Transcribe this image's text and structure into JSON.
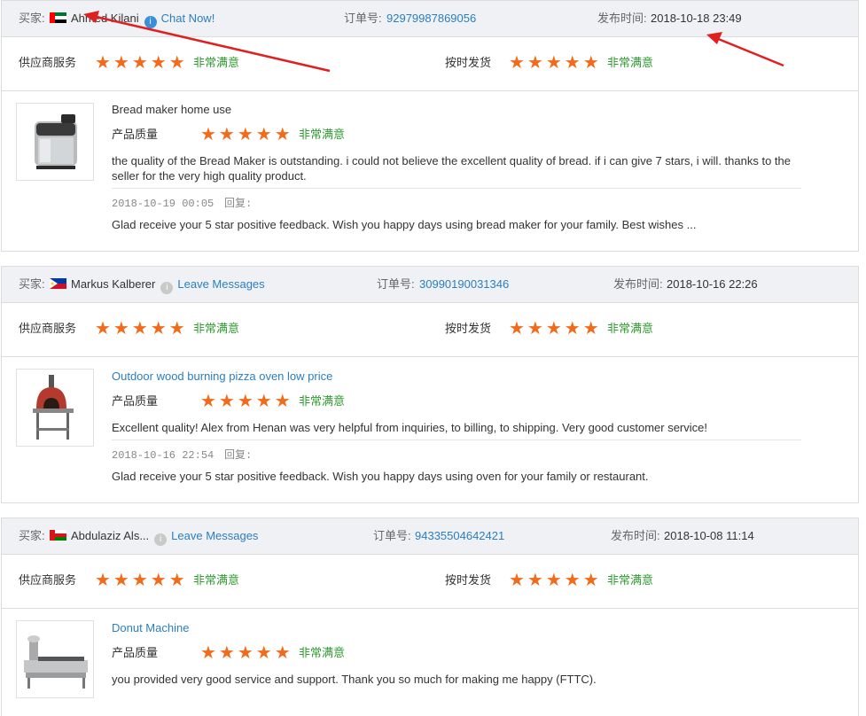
{
  "labels": {
    "buyer": "买家:",
    "order_no": "订单号:",
    "published_time": "发布时间:",
    "supplier_service": "供应商服务",
    "on_time_delivery": "按时发货",
    "product_quality": "产品质量",
    "reply": "回复:",
    "very_satisfied": "非常满意",
    "stars": "★★★★★"
  },
  "reviews": [
    {
      "buyer_name": "Ahmed Kilani",
      "contact_label": "Chat Now!",
      "order_number": "92979987869056",
      "published": "2018-10-18 23:49",
      "product_name": "Bread maker home use",
      "product_linked": false,
      "comment": "the quality of the Bread Maker is outstanding. i could not believe the excellent quality of bread. if i can give 7 stars, i will. thanks to the seller for the very high quality product.",
      "reply_time": "2018-10-19 00:05",
      "reply_text": "Glad receive your 5 star positive feedback. Wish you happy days using bread maker for your family. Best wishes ...",
      "supplier_service_rating": 5,
      "on_time_delivery_rating": 5,
      "product_quality_rating": 5
    },
    {
      "buyer_name": "Markus Kalberer",
      "contact_label": "Leave Messages",
      "order_number": "30990190031346",
      "published": "2018-10-16 22:26",
      "product_name": "Outdoor wood burning pizza oven low price",
      "product_linked": true,
      "comment": "Excellent quality! Alex from Henan was very helpful from inquiries, to billing, to shipping. Very good customer service!",
      "reply_time": "2018-10-16 22:54",
      "reply_text": "Glad receive your 5 star positive feedback. Wish you happy days using oven for your family or restaurant.",
      "supplier_service_rating": 5,
      "on_time_delivery_rating": 5,
      "product_quality_rating": 5
    },
    {
      "buyer_name": "Abdulaziz Als...",
      "contact_label": "Leave Messages",
      "order_number": "94335504642421",
      "published": "2018-10-08 11:14",
      "product_name": "Donut Machine",
      "product_linked": true,
      "comment": "you provided very good service and support. Thank you so much for making me happy (FTTC).",
      "supplier_service_rating": 5,
      "on_time_delivery_rating": 5,
      "product_quality_rating": 5
    }
  ],
  "colors": {
    "star": "#f26b1a",
    "satisfied": "#2e9b2e",
    "link": "#2a7fc1",
    "annotation_arrow": "#e02020"
  }
}
